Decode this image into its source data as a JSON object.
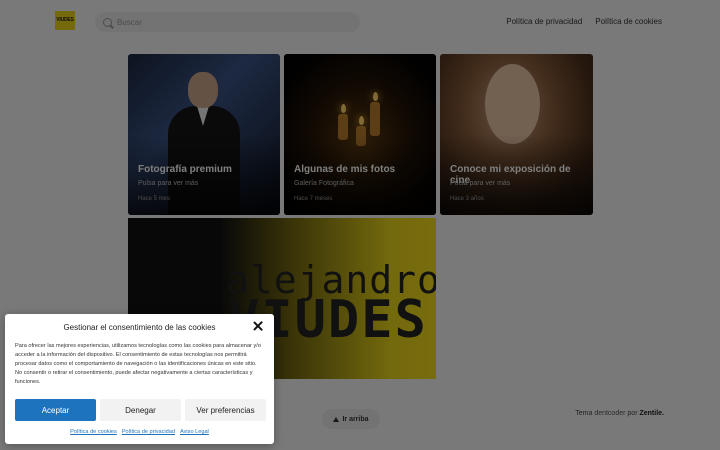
{
  "header": {
    "logo_text": "VIUDES",
    "search_placeholder": "Buscar",
    "nav": [
      "Política de privacidad",
      "Política de cookies"
    ]
  },
  "cards": [
    {
      "title": "Fotografía premium",
      "subtitle": "Pulsa para ver más",
      "time": "Hace 5 mes"
    },
    {
      "title": "Algunas de mis fotos",
      "subtitle": "Galería Fotográfica",
      "time": "Hace 7 meses"
    },
    {
      "title": "Conoce mi exposición de cine",
      "subtitle": "Pulsa para ver más",
      "time": "Hace 3 años"
    }
  ],
  "banner": {
    "line1": "alejandro",
    "line2": "VIUDES"
  },
  "footer": {
    "top_button": "Ir arriba",
    "credit_prefix": "Tema",
    "credit_link": "dentcoder",
    "credit_mid": "por",
    "credit_brand": "Zentile."
  },
  "consent": {
    "title": "Gestionar el consentimiento de las cookies",
    "body": "Para ofrecer las mejores experiencias, utilizamos tecnologías como las cookies para almacenar y/o acceder a la información del dispositivo. El consentimiento de estas tecnologías nos permitirá procesar datos como el comportamiento de navegación o las identificaciones únicas en este sitio. No consentir o retirar el consentimiento, puede afectar negativamente a ciertas características y funciones.",
    "accept_label": "Aceptar",
    "deny_label": "Denegar",
    "prefs_label": "Ver preferencias",
    "links": [
      "Política de cookies",
      "Política de privacidad",
      "Aviso Legal"
    ],
    "accent_color": "#1e73be"
  }
}
